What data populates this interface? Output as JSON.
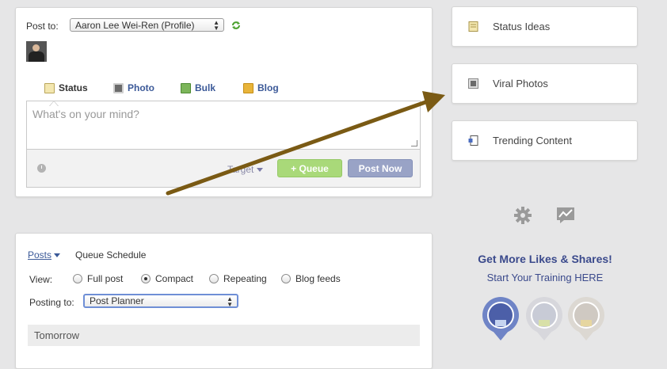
{
  "composer": {
    "post_to_label": "Post to:",
    "profile_selected": "Aaron Lee Wei-Ren (Profile)",
    "tabs": [
      {
        "label": "Status",
        "icon": "status-icon"
      },
      {
        "label": "Photo",
        "icon": "photo-icon"
      },
      {
        "label": "Bulk",
        "icon": "bulk-icon"
      },
      {
        "label": "Blog",
        "icon": "rss-icon"
      }
    ],
    "placeholder": "What's on your mind?",
    "target_label": "Target",
    "queue_button": "+ Queue",
    "post_now_button": "Post Now"
  },
  "sidebar": {
    "cards": [
      {
        "label": "Status Ideas",
        "icon": "note-icon"
      },
      {
        "label": "Viral Photos",
        "icon": "photo-icon"
      },
      {
        "label": "Trending Content",
        "icon": "trending-icon"
      }
    ],
    "promo_title": "Get More Likes & Shares!",
    "promo_link": "Start Your Training HERE"
  },
  "posts": {
    "posts_tab": "Posts",
    "queue_schedule": "Queue Schedule",
    "view_label": "View:",
    "view_options": [
      {
        "label": "Full post",
        "selected": false
      },
      {
        "label": "Compact",
        "selected": true
      },
      {
        "label": "Repeating",
        "selected": false
      },
      {
        "label": "Blog feeds",
        "selected": false
      }
    ],
    "posting_to_label": "Posting to:",
    "posting_to_selected": "Post Planner",
    "day_header": "Tomorrow"
  },
  "colors": {
    "link": "#3b5998",
    "queue_button": "#a9d979",
    "post_now_button": "#99a3c6",
    "arrow": "#7a5a14"
  }
}
